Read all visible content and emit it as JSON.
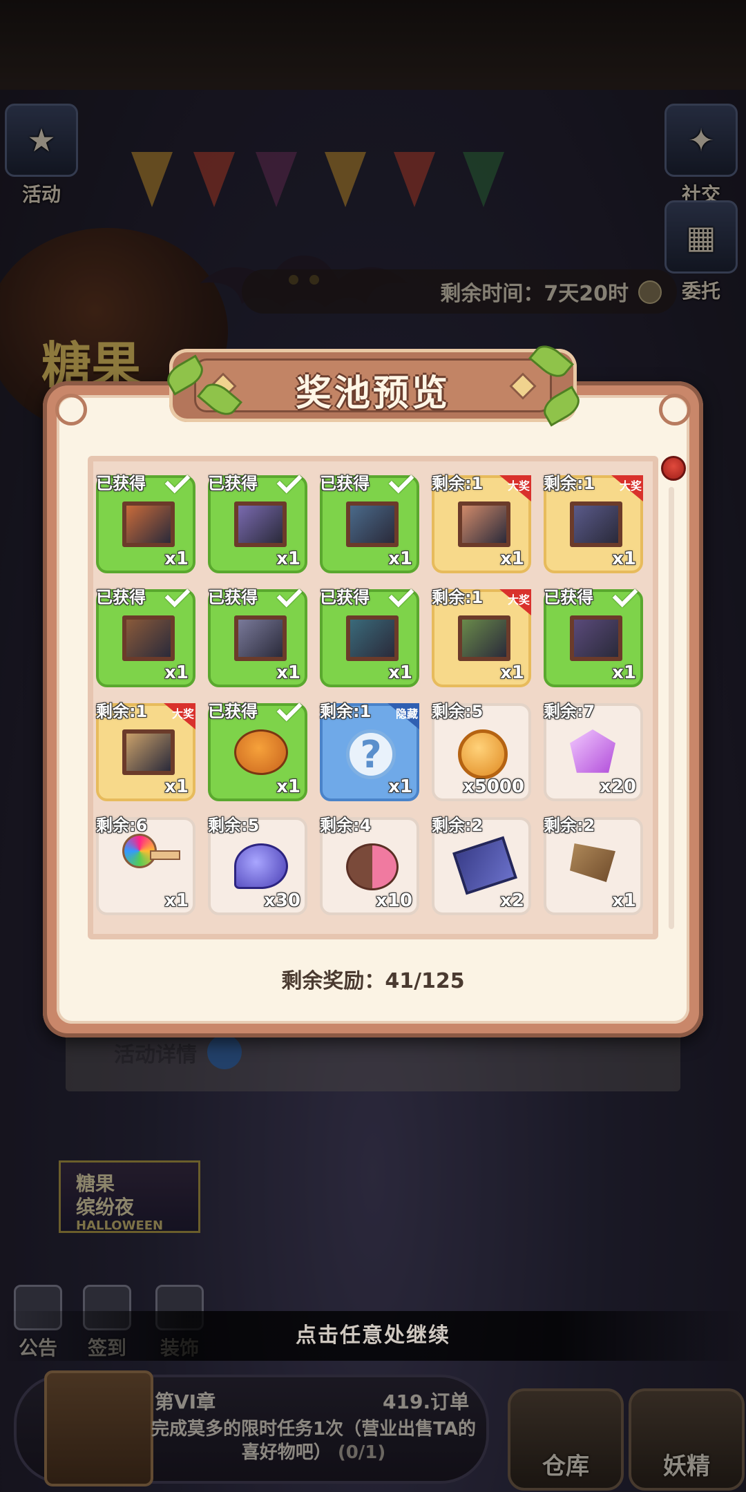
{
  "side_buttons": {
    "activity": "活动",
    "social": "社交",
    "commission": "委托"
  },
  "event_timer": "剩余时间：7天20时",
  "event_banner_text": "糖果",
  "activity_details": "活动详情",
  "event_thumb": {
    "line1": "糖果",
    "line2": "缤纷夜",
    "line3": "HALLOWEEN"
  },
  "bottom_nav": [
    "公告",
    "签到",
    "装饰"
  ],
  "continue_hint": "点击任意处继续",
  "quest": {
    "chapter": "第VI章",
    "orders": "419.订单",
    "text": "完成莫多的限时任务1次（营业出售TA的喜好物吧）",
    "progress": "(0/1)"
  },
  "big_buttons": {
    "warehouse": "仓库",
    "fairy": "妖精"
  },
  "modal": {
    "title": "奖池预览",
    "remaining_rewards": "剩余奖励：41/125",
    "grand_label": "大奖",
    "hidden_label": "隐藏",
    "items": [
      {
        "status": "已获得",
        "qty": "x1",
        "kind": "got",
        "icon": "pumpkin-painting-icon",
        "grand": false
      },
      {
        "status": "已获得",
        "qty": "x1",
        "kind": "got",
        "icon": "witch-painting-icon",
        "grand": false
      },
      {
        "status": "已获得",
        "qty": "x1",
        "kind": "got",
        "icon": "party-painting-icon",
        "grand": false
      },
      {
        "status": "剩余:1",
        "qty": "x1",
        "kind": "grand",
        "icon": "cake-painting-icon",
        "grand": true
      },
      {
        "status": "剩余:1",
        "qty": "x1",
        "kind": "grand",
        "icon": "night-painting-icon",
        "grand": true
      },
      {
        "status": "已获得",
        "qty": "x1",
        "kind": "got",
        "icon": "dog-painting-icon",
        "grand": false
      },
      {
        "status": "已获得",
        "qty": "x1",
        "kind": "got",
        "icon": "room-painting-icon",
        "grand": false
      },
      {
        "status": "已获得",
        "qty": "x1",
        "kind": "got",
        "icon": "street-painting-icon",
        "grand": false
      },
      {
        "status": "剩余:1",
        "qty": "x1",
        "kind": "grand",
        "icon": "garden-painting-icon",
        "grand": true
      },
      {
        "status": "已获得",
        "qty": "x1",
        "kind": "got",
        "icon": "crowd-painting-icon",
        "grand": false
      },
      {
        "status": "剩余:1",
        "qty": "x1",
        "kind": "grand",
        "icon": "bouquet-painting-icon",
        "grand": true
      },
      {
        "status": "已获得",
        "qty": "x1",
        "kind": "got",
        "icon": "pumpkin-witch-icon",
        "grand": false
      },
      {
        "status": "剩余:1",
        "qty": "x1",
        "kind": "hidden",
        "icon": "question-mark-icon",
        "grand": false
      },
      {
        "status": "剩余:5",
        "qty": "x5000",
        "kind": "normal",
        "icon": "gold-coin-icon",
        "grand": false
      },
      {
        "status": "剩余:7",
        "qty": "x20",
        "kind": "normal",
        "icon": "purple-gem-icon",
        "grand": false
      },
      {
        "status": "剩余:6",
        "qty": "x1",
        "kind": "normal",
        "icon": "rainbow-key-icon",
        "grand": false
      },
      {
        "status": "剩余:5",
        "qty": "x30",
        "kind": "normal",
        "icon": "hourglass-icon",
        "grand": false
      },
      {
        "status": "剩余:4",
        "qty": "x10",
        "kind": "normal",
        "icon": "macaron-icon",
        "grand": false
      },
      {
        "status": "剩余:2",
        "qty": "x2",
        "kind": "normal",
        "icon": "ticket-icon",
        "grand": false
      },
      {
        "status": "剩余:2",
        "qty": "x1",
        "kind": "normal",
        "icon": "wood-material-icon",
        "grand": false
      }
    ]
  }
}
